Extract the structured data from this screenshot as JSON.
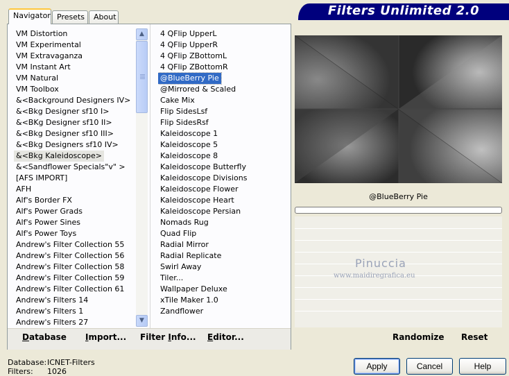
{
  "banner": {
    "title": "Filters Unlimited 2.0"
  },
  "tabs": [
    {
      "label": "Navigator",
      "active": true
    },
    {
      "label": "Presets",
      "active": false
    },
    {
      "label": "About",
      "active": false
    }
  ],
  "categories": {
    "selected": "&<Bkg Kaleidoscope>",
    "items": [
      "VM Distortion",
      "VM Experimental",
      "VM Extravaganza",
      "VM Instant Art",
      "VM Natural",
      "VM Toolbox",
      "&<Background Designers IV>",
      "&<Bkg Designer sf10 I>",
      "&<BKg Designer sf10 II>",
      "&<Bkg Designer sf10 III>",
      "&<Bkg Designers sf10 IV>",
      "&<Bkg Kaleidoscope>",
      "&<Sandflower Specials\"v\" >",
      "[AFS IMPORT]",
      "AFH",
      "Alf's Border FX",
      "Alf's Power Grads",
      "Alf's Power Sines",
      "Alf's Power Toys",
      "Andrew's Filter Collection 55",
      "Andrew's Filter Collection 56",
      "Andrew's Filter Collection 58",
      "Andrew's Filter Collection 59",
      "Andrew's Filter Collection 61",
      "Andrew's Filters 14",
      "Andrew's Filters 1",
      "Andrew's Filters 27"
    ]
  },
  "filters": {
    "selected": "@BlueBerry Pie",
    "items": [
      "4 QFlip UpperL",
      "4 QFlip UpperR",
      "4 QFlip ZBottomL",
      "4 QFlip ZBottomR",
      "@BlueBerry Pie",
      "@Mirrored & Scaled",
      "Cake Mix",
      "Flip SidesLsf",
      "Flip SidesRsf",
      "Kaleidoscope 1",
      "Kaleidoscope 5",
      "Kaleidoscope 8",
      "Kaleidoscope Butterfly",
      "Kaleidoscope Divisions",
      "Kaleidoscope Flower",
      "Kaleidoscope Heart",
      "Kaleidoscope Persian",
      "Nomads Rug",
      "Quad Flip",
      "Radial Mirror",
      "Radial Replicate",
      "Swirl Away",
      "Tiler...",
      "Wallpaper Deluxe",
      "xTile Maker 1.0",
      "Zandflower"
    ]
  },
  "nav_buttons": {
    "database": {
      "ul": "D",
      "rest": "atabase"
    },
    "import": {
      "ul": "I",
      "rest": "mport..."
    },
    "filter_info": {
      "pre": "Filter ",
      "ul": "I",
      "rest": "nfo..."
    },
    "editor": {
      "ul": "E",
      "rest": "ditor..."
    }
  },
  "preview": {
    "filter_name": "@BlueBerry Pie",
    "watermark_name": "Pinuccia",
    "watermark_url": "www.maidiregrafica.eu"
  },
  "actions": {
    "randomize": "Randomize",
    "reset": "Reset"
  },
  "status": {
    "database_label": "Database:",
    "database_value": "ICNET-Filters",
    "filters_label": "Filters:",
    "filters_value": "1026"
  },
  "dialog": {
    "apply": "Apply",
    "cancel": "Cancel",
    "help": "Help"
  },
  "colors": {
    "banner": "#00007d",
    "selection": "#316ac5",
    "face": "#ece9d8"
  },
  "icons": {
    "scroll_up": "scroll-up-arrow-icon",
    "scroll_down": "scroll-down-arrow-icon"
  }
}
